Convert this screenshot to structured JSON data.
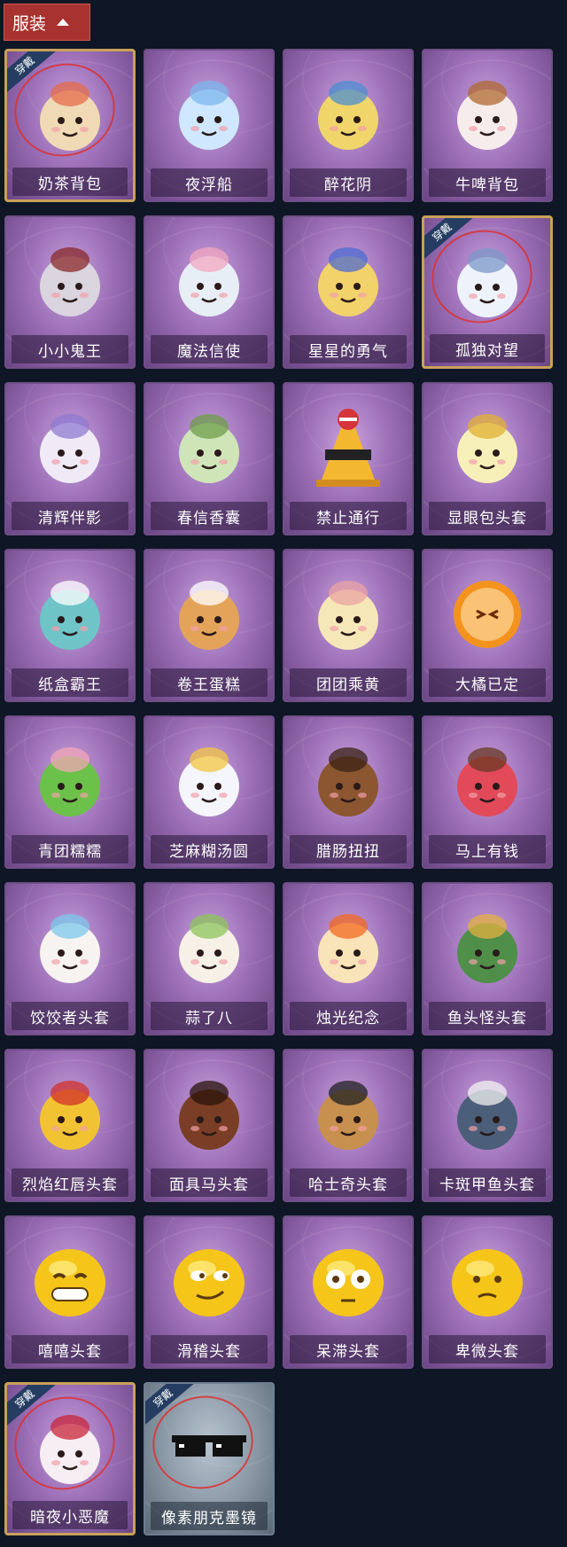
{
  "header": {
    "label": "服装"
  },
  "worn_badge_label": "穿戴",
  "items": [
    {
      "label": "奶茶背包",
      "worn": true,
      "icon": "milk-tea-backpack",
      "color": "#f0d9b5",
      "accent": "#e46b4a"
    },
    {
      "label": "夜浮船",
      "worn": false,
      "icon": "jellyfish-charm",
      "color": "#cfe8ff",
      "accent": "#7bb7ee"
    },
    {
      "label": "醉花阴",
      "worn": false,
      "icon": "dreamcatcher",
      "color": "#f0d56a",
      "accent": "#4c8ed0"
    },
    {
      "label": "牛啤背包",
      "worn": false,
      "icon": "cow-barrel",
      "color": "#f6ecec",
      "accent": "#b06a30"
    },
    {
      "label": "小小鬼王",
      "worn": false,
      "icon": "chibi-ghost-king",
      "color": "#d9d4de",
      "accent": "#8a2a2a"
    },
    {
      "label": "魔法信使",
      "worn": false,
      "icon": "elephant",
      "color": "#e8eef6",
      "accent": "#f3a7c0"
    },
    {
      "label": "星星的勇气",
      "worn": false,
      "icon": "star-chibi",
      "color": "#f2d26a",
      "accent": "#4c6bd0"
    },
    {
      "label": "孤独对望",
      "worn": true,
      "icon": "white-haired-chibi",
      "color": "#eef3fb",
      "accent": "#7b97c7"
    },
    {
      "label": "清辉伴影",
      "worn": false,
      "icon": "horned-chibi",
      "color": "#efeaf6",
      "accent": "#8f7ad0"
    },
    {
      "label": "春信香囊",
      "worn": false,
      "icon": "green-sachet",
      "color": "#cfe5b8",
      "accent": "#6e9d4a"
    },
    {
      "label": "禁止通行",
      "worn": false,
      "icon": "no-entry-cone",
      "color": "#f3b830",
      "accent": "#222222"
    },
    {
      "label": "显眼包头套",
      "worn": false,
      "icon": "lightbulb-head",
      "color": "#f6f0b8",
      "accent": "#e0b030"
    },
    {
      "label": "纸盒霸王",
      "worn": false,
      "icon": "box-dino",
      "color": "#6fc4c8",
      "accent": "#ffffff"
    },
    {
      "label": "卷王蛋糕",
      "worn": false,
      "icon": "roll-cake",
      "color": "#e3a45a",
      "accent": "#ffffff"
    },
    {
      "label": "团团乘黄",
      "worn": false,
      "icon": "fluffy-bun",
      "color": "#f6e7b8",
      "accent": "#e9a3a3"
    },
    {
      "label": "大橘已定",
      "worn": false,
      "icon": "orange-slice",
      "color": "#f3931e",
      "accent": "#fff2cc"
    },
    {
      "label": "青团糯糯",
      "worn": false,
      "icon": "green-mochi",
      "color": "#6cc14a",
      "accent": "#f2a5b5"
    },
    {
      "label": "芝麻糊汤圆",
      "worn": false,
      "icon": "tangyuan",
      "color": "#f4f6fb",
      "accent": "#f3c640"
    },
    {
      "label": "腊肠扭扭",
      "worn": false,
      "icon": "dog-head",
      "color": "#8b5630",
      "accent": "#3b2314"
    },
    {
      "label": "马上有钱",
      "worn": false,
      "icon": "pink-horse",
      "color": "#e24a5a",
      "accent": "#6b3a24"
    },
    {
      "label": "饺饺者头套",
      "worn": false,
      "icon": "dumpling-cloud",
      "color": "#f6f3f0",
      "accent": "#7cc8ec"
    },
    {
      "label": "蒜了八",
      "worn": false,
      "icon": "garlic",
      "color": "#f6f0e6",
      "accent": "#8cc45a"
    },
    {
      "label": "烛光纪念",
      "worn": false,
      "icon": "candle",
      "color": "#f9e3b8",
      "accent": "#f26a20"
    },
    {
      "label": "鱼头怪头套",
      "worn": false,
      "icon": "fish-head",
      "color": "#4f8f4a",
      "accent": "#e3b040"
    },
    {
      "label": "烈焰红唇头套",
      "worn": false,
      "icon": "yellow-mask",
      "color": "#f1c232",
      "accent": "#d2302a"
    },
    {
      "label": "面具马头套",
      "worn": false,
      "icon": "horse-mask",
      "color": "#7a3e26",
      "accent": "#2a140a"
    },
    {
      "label": "哈士奇头套",
      "worn": false,
      "icon": "husky-head",
      "color": "#c8904e",
      "accent": "#222222"
    },
    {
      "label": "卡斑甲鱼头套",
      "worn": false,
      "icon": "seal-head",
      "color": "#4c5f7a",
      "accent": "#f1f1f1"
    },
    {
      "label": "嘻嘻头套",
      "worn": false,
      "icon": "grin-emoji",
      "color": "#f5c519",
      "accent": "#5a3a10"
    },
    {
      "label": "滑稽头套",
      "worn": false,
      "icon": "smirk-emoji",
      "color": "#f5c519",
      "accent": "#5a3a10"
    },
    {
      "label": "呆滞头套",
      "worn": false,
      "icon": "stare-emoji",
      "color": "#f5c519",
      "accent": "#5a3a10"
    },
    {
      "label": "卑微头套",
      "worn": false,
      "icon": "humble-emoji",
      "color": "#f5c519",
      "accent": "#5a3a10"
    },
    {
      "label": "暗夜小恶魔",
      "worn": true,
      "icon": "devil-head",
      "color": "#f6eef2",
      "accent": "#c8243a"
    },
    {
      "label": "像素朋克墨镜",
      "worn": true,
      "icon": "pixel-sunglasses",
      "color": "#111111",
      "accent": "#ffffff",
      "gray": true
    }
  ]
}
